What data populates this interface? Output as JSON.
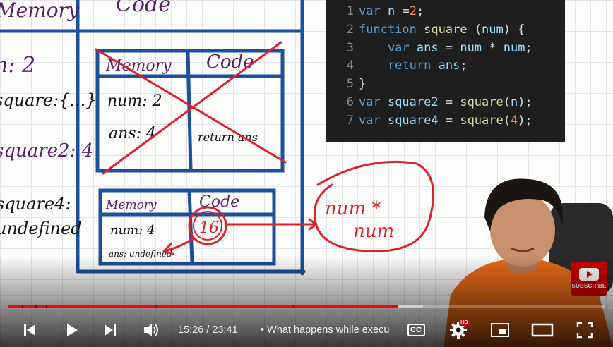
{
  "video": {
    "title": "What happens while execu",
    "current_time": "15:26",
    "duration": "23:41",
    "time_separator": " / ",
    "progress_fraction": 0.653,
    "buffered_fraction": 0.695,
    "chapter_marks": [
      0.022,
      0.045,
      0.063,
      0.248,
      0.478
    ]
  },
  "whiteboard": {
    "outer_memory_header": "Memory",
    "outer_code_header": "Code",
    "left_entries": [
      "n: 2",
      "square:{...}",
      "square2: 4",
      "square4:",
      "undefined"
    ],
    "box1": {
      "memory_header": "Memory",
      "code_header": "Code",
      "num": "num: 2",
      "ans": "ans: 4",
      "code_text": "return ans"
    },
    "box2": {
      "memory_header": "Memory",
      "code_header": "Code",
      "num": "num: 4",
      "ans": "ans: undefined",
      "circled": "16"
    },
    "cloud_text": [
      "num *",
      "num"
    ]
  },
  "code": {
    "lines": [
      {
        "n": "1",
        "tokens": [
          {
            "t": "var ",
            "c": "kw"
          },
          {
            "t": "n ",
            "c": "vr"
          },
          {
            "t": "=",
            "c": "op"
          },
          {
            "t": "2",
            "c": "nm"
          },
          {
            "t": ";",
            "c": "op"
          }
        ]
      },
      {
        "n": "2",
        "tokens": [
          {
            "t": "function ",
            "c": "kw"
          },
          {
            "t": "square ",
            "c": "fn"
          },
          {
            "t": "(",
            "c": "op"
          },
          {
            "t": "num",
            "c": "vr"
          },
          {
            "t": ") {",
            "c": "op"
          }
        ]
      },
      {
        "n": "3",
        "tokens": [
          {
            "t": "    var ",
            "c": "kw"
          },
          {
            "t": "ans ",
            "c": "vr"
          },
          {
            "t": "= ",
            "c": "op"
          },
          {
            "t": "num ",
            "c": "vr"
          },
          {
            "t": "* ",
            "c": "op"
          },
          {
            "t": "num",
            "c": "vr"
          },
          {
            "t": ";",
            "c": "op"
          }
        ]
      },
      {
        "n": "4",
        "tokens": [
          {
            "t": "    return ",
            "c": "kw"
          },
          {
            "t": "ans",
            "c": "vr"
          },
          {
            "t": ";",
            "c": "op"
          }
        ]
      },
      {
        "n": "5",
        "tokens": [
          {
            "t": "}",
            "c": "op"
          }
        ]
      },
      {
        "n": "6",
        "tokens": [
          {
            "t": "var ",
            "c": "kw"
          },
          {
            "t": "square2 ",
            "c": "vr"
          },
          {
            "t": "= ",
            "c": "op"
          },
          {
            "t": "square",
            "c": "fn"
          },
          {
            "t": "(",
            "c": "op"
          },
          {
            "t": "n",
            "c": "vr"
          },
          {
            "t": ");",
            "c": "op"
          }
        ]
      },
      {
        "n": "7",
        "tokens": [
          {
            "t": "var ",
            "c": "kw"
          },
          {
            "t": "square4 ",
            "c": "vr"
          },
          {
            "t": "= ",
            "c": "op"
          },
          {
            "t": "square",
            "c": "fn"
          },
          {
            "t": "(",
            "c": "op"
          },
          {
            "t": "4",
            "c": "nm"
          },
          {
            "t": ");",
            "c": "op"
          }
        ]
      }
    ]
  },
  "subscribe": {
    "label": "SUBSCRIBE"
  },
  "controls": {
    "cc_label": "CC",
    "hd_badge": "HD"
  },
  "icons": {
    "prev": "skip-previous-icon",
    "play": "play-icon",
    "next": "skip-next-icon",
    "volume": "volume-icon",
    "cc": "closed-captions-icon",
    "settings": "settings-gear-icon",
    "miniplayer": "miniplayer-icon",
    "theater": "theater-mode-icon",
    "fullscreen": "fullscreen-icon"
  },
  "colors": {
    "board_blue": "#1c4f9c",
    "marker_purple": "#5a1f6b",
    "marker_red": "#e0202a",
    "progress_red": "#ff0000",
    "code_bg": "#1e1e1e",
    "shirt_orange": "#e86a17"
  }
}
